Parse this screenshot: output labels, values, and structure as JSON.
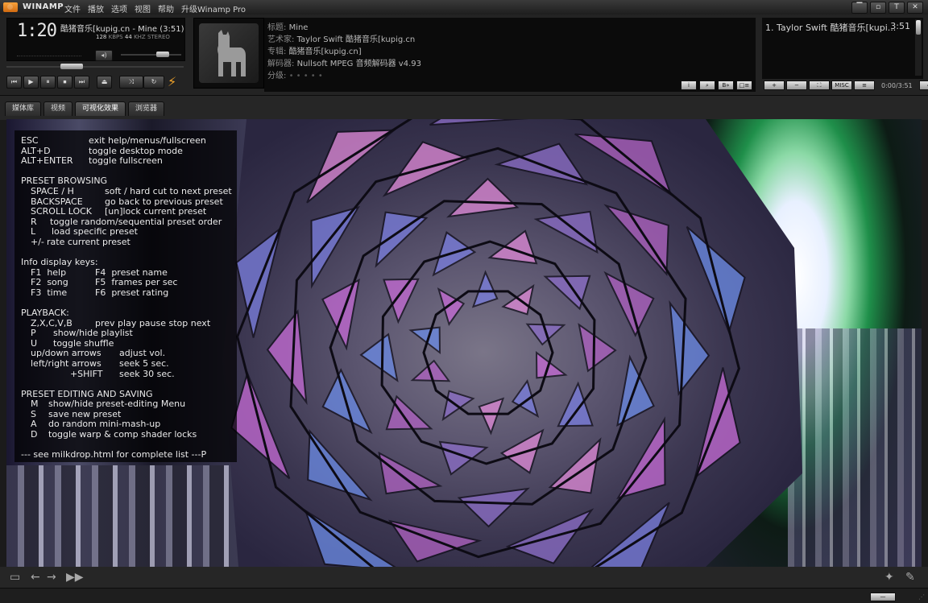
{
  "window": {
    "app_title": "WINAMP",
    "menu": [
      "文件",
      "播放",
      "选项",
      "视图",
      "帮助",
      "升级Winamp Pro"
    ],
    "controls": [
      "▔",
      "▫",
      "T",
      "✕"
    ]
  },
  "player": {
    "time": "1:20",
    "song_title": "酷猪音乐[kupig.cn - Mine (3:51)",
    "kbps": "128",
    "kbps_unit": "KBPS",
    "khz": "44",
    "khz_unit": "KHZ",
    "mode": "STEREO",
    "position_fraction": 0.35,
    "volume_fraction": 0.75,
    "transport": [
      "⏮",
      "▶",
      "⏸",
      "⏹",
      "⏭"
    ],
    "eject": "⏏",
    "shuffle": "⤨",
    "repeat": "↻"
  },
  "info": {
    "title_key": "标题:",
    "title_val": "Mine",
    "artist_key": "艺术家:",
    "artist_val": "Taylor Swift 酷猪音乐[kupig.cn",
    "album_key": "专辑:",
    "album_val": "酷猪音乐[kupig.cn]",
    "decoder_key": "解码器:",
    "decoder_val": "Nullsoft MPEG 音频解码器 v4.93",
    "rating_key": "分级:",
    "rating_val": "• • • • •",
    "buttons": [
      "i",
      "⌕",
      "B»",
      "□≡"
    ]
  },
  "playlist": {
    "item": "1. Taylor Swift 酷猪音乐[kupi...",
    "duration": "3:51",
    "controls": [
      "+",
      "−",
      "⛶",
      "MISC",
      "≡"
    ],
    "time": "0:00/3:51",
    "end_btn": "◇"
  },
  "tabs": [
    {
      "label": "媒体库",
      "active": false
    },
    {
      "label": "视频",
      "active": false
    },
    {
      "label": "可视化效果",
      "active": true
    },
    {
      "label": "浏览器",
      "active": false
    }
  ],
  "help": [
    {
      "k": "ESC",
      "v": "exit help/menus/fullscreen",
      "ind": false,
      "off": 84
    },
    {
      "k": "ALT+D",
      "v": "toggle desktop mode",
      "ind": false,
      "off": 84
    },
    {
      "k": "ALT+ENTER",
      "v": "toggle fullscreen",
      "ind": false,
      "off": 84
    },
    {
      "k": "",
      "v": "",
      "ind": false,
      "off": 0
    },
    {
      "k": "PRESET BROWSING",
      "v": "",
      "ind": false,
      "off": 0
    },
    {
      "k": "SPACE / H",
      "v": "soft / hard cut to next preset",
      "ind": true,
      "off": 92
    },
    {
      "k": "BACKSPACE",
      "v": "go back to previous preset",
      "ind": true,
      "off": 92
    },
    {
      "k": "SCROLL LOCK",
      "v": "[un]lock current preset",
      "ind": true,
      "off": 92
    },
    {
      "k": "R",
      "v": "toggle random/sequential preset order",
      "ind": true,
      "off": 24
    },
    {
      "k": "L",
      "v": "load specific preset",
      "ind": true,
      "off": 26
    },
    {
      "k": "+/-",
      "v": "rate current preset",
      "ind": true,
      "off": 20
    },
    {
      "k": "",
      "v": "",
      "ind": false,
      "off": 0
    },
    {
      "k": "Info display keys:",
      "v": "",
      "ind": false,
      "off": 0
    },
    {
      "k": "F1  help",
      "v": "F4  preset name",
      "ind": true,
      "off": 80
    },
    {
      "k": "F2  song",
      "v": "F5  frames per sec",
      "ind": true,
      "off": 80
    },
    {
      "k": "F3  time",
      "v": "F6  preset rating",
      "ind": true,
      "off": 80
    },
    {
      "k": "",
      "v": "",
      "ind": false,
      "off": 0
    },
    {
      "k": "PLAYBACK:",
      "v": "",
      "ind": false,
      "off": 0
    },
    {
      "k": "Z,X,C,V,B",
      "v": "prev play pause stop next",
      "ind": true,
      "off": 80
    },
    {
      "k": "P",
      "v": "show/hide playlist",
      "ind": true,
      "off": 28
    },
    {
      "k": "U",
      "v": "toggle shuffle",
      "ind": true,
      "off": 28
    },
    {
      "k": "up/down arrows",
      "v": "adjust vol.",
      "ind": true,
      "off": 110
    },
    {
      "k": "left/right arrows",
      "v": "seek 5 sec.",
      "ind": true,
      "off": 110
    },
    {
      "k": "              +SHIFT",
      "v": "seek 30 sec.",
      "ind": true,
      "off": 110
    },
    {
      "k": "",
      "v": "",
      "ind": false,
      "off": 0
    },
    {
      "k": "PRESET EDITING AND SAVING",
      "v": "",
      "ind": false,
      "off": 0
    },
    {
      "k": "M",
      "v": "show/hide preset-editing Menu",
      "ind": true,
      "off": 22
    },
    {
      "k": "S",
      "v": "save new preset",
      "ind": true,
      "off": 22
    },
    {
      "k": "A",
      "v": "do random mini-mash-up",
      "ind": true,
      "off": 22
    },
    {
      "k": "D",
      "v": "toggle warp & comp shader locks",
      "ind": true,
      "off": 22
    },
    {
      "k": "",
      "v": "",
      "ind": false,
      "off": 0
    },
    {
      "k": "--- see milkdrop.html for complete list ---P",
      "v": "",
      "ind": false,
      "off": 0
    }
  ],
  "bottom": {
    "left_icons": [
      "▭",
      "←",
      "→",
      "▶▶"
    ],
    "right_icons": [
      "✦",
      "✎"
    ],
    "status_btn": "—"
  },
  "colors": {
    "accent": "#f3a42a",
    "lcd_bg": "#0b0b0b",
    "viz_pink": "#d47ad8",
    "viz_blue": "#6b7fe0"
  }
}
